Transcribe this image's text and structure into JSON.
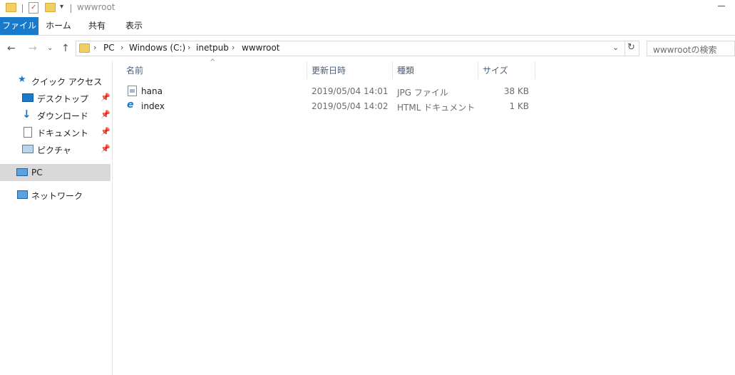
{
  "window": {
    "title": "wwwroot"
  },
  "ribbon": {
    "tabs": [
      "ファイル",
      "ホーム",
      "共有",
      "表示"
    ]
  },
  "address": {
    "crumbs": [
      "PC",
      "Windows (C:)",
      "inetpub",
      "wwwroot"
    ],
    "search_placeholder": "wwwrootの検索"
  },
  "nav": {
    "quick_access": "クイック アクセス",
    "pinned": [
      "デスクトップ",
      "ダウンロード",
      "ドキュメント",
      "ピクチャ"
    ],
    "pc": "PC",
    "network": "ネットワーク"
  },
  "columns": {
    "name": "名前",
    "date": "更新日時",
    "type": "種類",
    "size": "サイズ"
  },
  "files": [
    {
      "name": "hana",
      "date": "2019/05/04 14:01",
      "type": "JPG ファイル",
      "size": "38 KB",
      "icon": "jpg-file-icon"
    },
    {
      "name": "index",
      "date": "2019/05/04 14:02",
      "type": "HTML ドキュメント",
      "size": "1 KB",
      "icon": "html-ie-file-icon"
    }
  ],
  "colors": {
    "accent": "#1979ca",
    "selected": "#d9d9d9",
    "folder": "#f3cf63"
  }
}
